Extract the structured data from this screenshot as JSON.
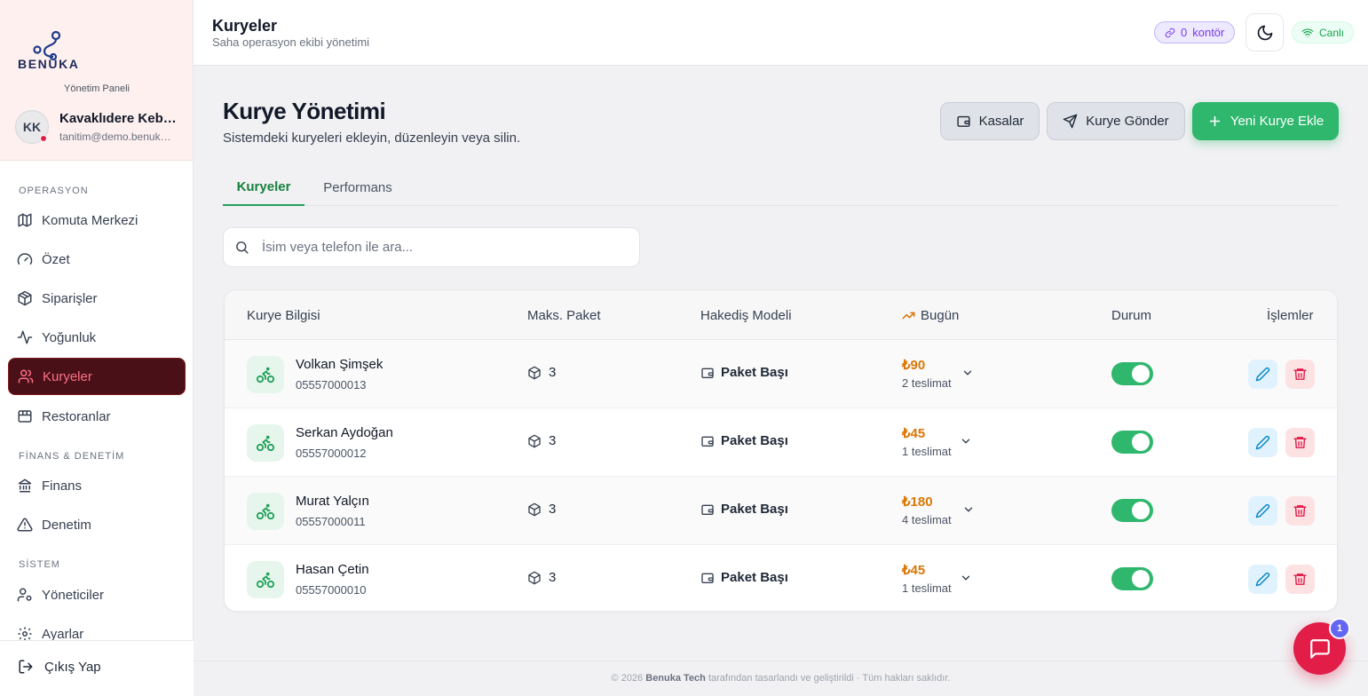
{
  "brand": {
    "name": "BENUKA",
    "panel_label": "Yönetim Paneli"
  },
  "user": {
    "initials": "KK",
    "name": "Kavaklıdere Kebap",
    "email": "tanitim@demo.benuka.com"
  },
  "sidebar": {
    "sections": [
      {
        "label": "OPERASYON"
      },
      {
        "label": "FİNANS & DENETİM"
      },
      {
        "label": "SİSTEM"
      }
    ],
    "items": [
      {
        "label": "Komuta Merkezi",
        "icon": "map-icon"
      },
      {
        "label": "Özet",
        "icon": "gauge-icon"
      },
      {
        "label": "Siparişler",
        "icon": "package-icon"
      },
      {
        "label": "Yoğunluk",
        "icon": "activity-icon"
      },
      {
        "label": "Kuryeler",
        "icon": "users-icon",
        "active": true
      },
      {
        "label": "Restoranlar",
        "icon": "store-icon"
      },
      {
        "label": "Finans",
        "icon": "bank-icon"
      },
      {
        "label": "Denetim",
        "icon": "alert-triangle-icon"
      },
      {
        "label": "Yöneticiler",
        "icon": "user-cog-icon"
      },
      {
        "label": "Ayarlar",
        "icon": "gear-icon"
      }
    ],
    "logout": "Çıkış Yap"
  },
  "header": {
    "title": "Kuryeler",
    "subtitle": "Saha operasyon ekibi yönetimi",
    "credit_count": "0",
    "credit_label": "kontör",
    "live_label": "Canlı"
  },
  "page": {
    "title": "Kurye Yönetimi",
    "subtitle": "Sistemdeki kuryeleri ekleyin, düzenleyin veya silin.",
    "buttons": {
      "cash": "Kasalar",
      "send": "Kurye Gönder",
      "add": "Yeni Kurye Ekle"
    },
    "tabs": [
      "Kuryeler",
      "Performans"
    ],
    "search_placeholder": "İsim veya telefon ile ara..."
  },
  "table": {
    "columns": [
      "Kurye Bilgisi",
      "Maks. Paket",
      "Hakediş Modeli",
      "Bugün",
      "Durum",
      "İşlemler"
    ],
    "rows": [
      {
        "name": "Volkan Şimşek",
        "phone": "05557000013",
        "max_package": "3",
        "model": "Paket Başı",
        "today_amount": "₺90",
        "today_count": "2 teslimat",
        "active": true
      },
      {
        "name": "Serkan Aydoğan",
        "phone": "05557000012",
        "max_package": "3",
        "model": "Paket Başı",
        "today_amount": "₺45",
        "today_count": "1 teslimat",
        "active": true
      },
      {
        "name": "Murat Yalçın",
        "phone": "05557000011",
        "max_package": "3",
        "model": "Paket Başı",
        "today_amount": "₺180",
        "today_count": "4 teslimat",
        "active": true
      },
      {
        "name": "Hasan Çetin",
        "phone": "05557000010",
        "max_package": "3",
        "model": "Paket Başı",
        "today_amount": "₺45",
        "today_count": "1 teslimat",
        "active": true
      }
    ]
  },
  "footer": {
    "prefix": "© 2026",
    "company": "Benuka Tech",
    "suffix": "tarafından tasarlandı ve geliştirildi · Tüm hakları saklıdır."
  },
  "chat": {
    "badge": "1"
  },
  "colors": {
    "accent": "#2fb76d",
    "brand_red": "#e11d48",
    "earnings": "#d97706"
  }
}
